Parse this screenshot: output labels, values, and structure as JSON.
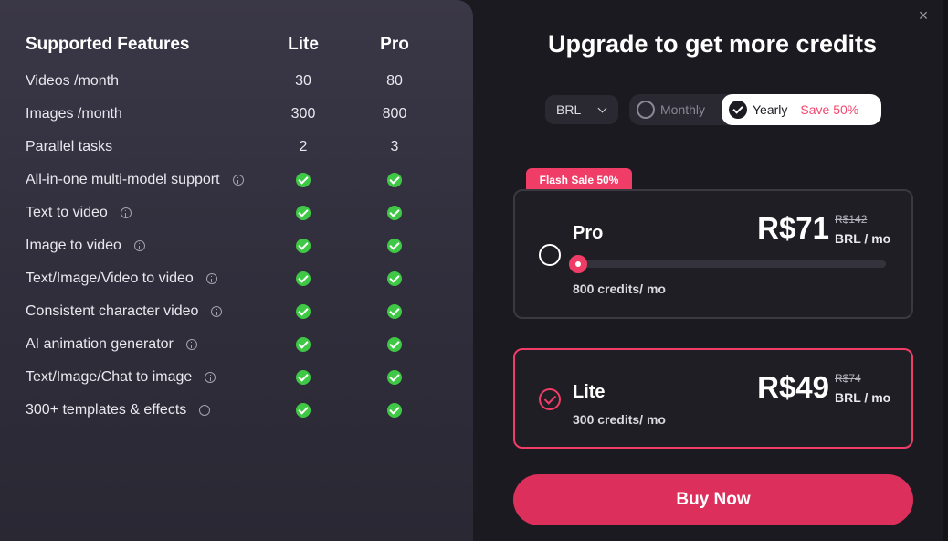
{
  "features": {
    "header": "Supported Features",
    "col_lite": "Lite",
    "col_pro": "Pro",
    "rows": [
      {
        "label": "Videos /month",
        "lite": "30",
        "pro": "80",
        "info": false,
        "check": false
      },
      {
        "label": "Images /month",
        "lite": "300",
        "pro": "800",
        "info": false,
        "check": false
      },
      {
        "label": "Parallel tasks",
        "lite": "2",
        "pro": "3",
        "info": false,
        "check": false
      },
      {
        "label": "All-in-one multi-model support",
        "info": true,
        "check": true
      },
      {
        "label": "Text to video",
        "info": true,
        "check": true
      },
      {
        "label": "Image to video",
        "info": true,
        "check": true
      },
      {
        "label": "Text/Image/Video to video",
        "info": true,
        "check": true
      },
      {
        "label": "Consistent character video",
        "info": true,
        "check": true
      },
      {
        "label": "AI animation generator",
        "info": true,
        "check": true
      },
      {
        "label": "Text/Image/Chat to image",
        "info": true,
        "check": true
      },
      {
        "label": "300+ templates & effects",
        "info": true,
        "check": true
      }
    ]
  },
  "modal": {
    "title": "Upgrade to get more credits",
    "close_icon": "×"
  },
  "currency": {
    "value": "BRL"
  },
  "billing": {
    "monthly_label": "Monthly",
    "yearly_label": "Yearly",
    "save_label": "Save 50%",
    "selected": "yearly"
  },
  "plans": {
    "flash_badge": "Flash Sale 50%",
    "pro": {
      "name": "Pro",
      "price": "R$71",
      "old_price": "R$142",
      "per": "BRL / mo",
      "credits": "800 credits/ mo",
      "slider_level": 0
    },
    "lite": {
      "name": "Lite",
      "price": "R$49",
      "old_price": "R$74",
      "per": "BRL / mo",
      "credits": "300 credits/ mo",
      "selected": true
    }
  },
  "buy_label": "Buy Now",
  "colors": {
    "accent": "#ef3d67",
    "button": "#dd2f5b",
    "check": "#3fc845",
    "panel_left": "#3a3747",
    "panel_right": "#1b1a21"
  }
}
